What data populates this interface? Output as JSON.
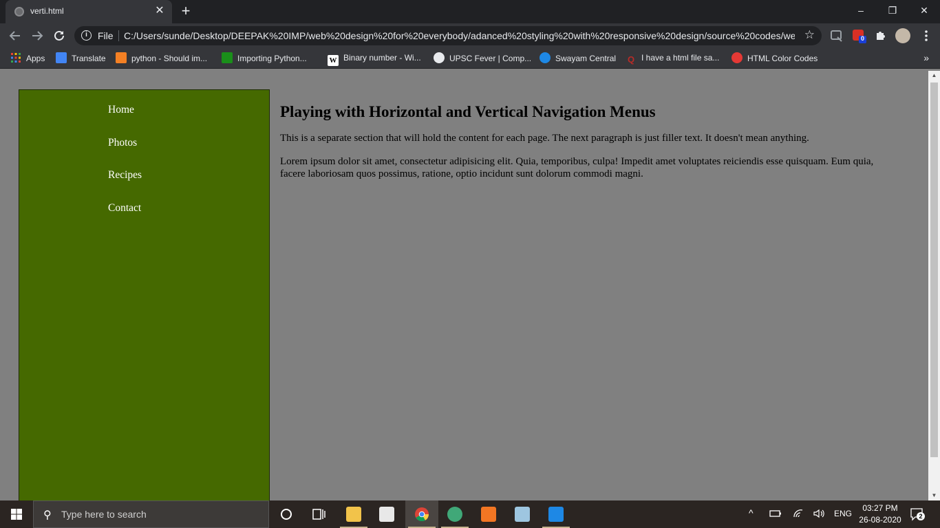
{
  "browser": {
    "tab_title": "verti.html",
    "tab_close": "✕",
    "new_tab": "+",
    "file_label": "File",
    "url": "C:/Users/sunde/Desktop/DEEPAK%20IMP/web%20design%20for%20everybody/adanced%20styling%20with%20responsive%20design/source%20codes/we...",
    "extension_badge": "0",
    "window_controls": [
      "–",
      "❐",
      "✕"
    ]
  },
  "bookmarks": [
    {
      "label": "Apps",
      "icon": "apps-grid-icon",
      "color": "#e94235"
    },
    {
      "label": "Translate",
      "icon": "translate-icon",
      "color": "#4285f4"
    },
    {
      "label": "python - Should im...",
      "icon": "stackoverflow-icon",
      "color": "#f48024"
    },
    {
      "label": "Importing Python...",
      "icon": "green-square-icon",
      "color": "#1a8f1a"
    },
    {
      "label": "Binary number - Wi...",
      "icon": "wikipedia-icon",
      "color": "#ffffff"
    },
    {
      "label": "UPSC Fever | Comp...",
      "icon": "globe-icon",
      "color": "#e8eaed"
    },
    {
      "label": "Swayam Central",
      "icon": "swayam-icon",
      "color": "#1e88e5"
    },
    {
      "label": "I have a html file sa...",
      "icon": "quora-icon",
      "color": "#b92b27"
    },
    {
      "label": "HTML Color Codes",
      "icon": "color-codes-icon",
      "color": "#e53935"
    }
  ],
  "page": {
    "nav": [
      "Home",
      "Photos",
      "Recipes",
      "Contact"
    ],
    "heading": "Playing with Horizontal and Vertical Navigation Menus",
    "para1": "This is a separate section that will hold the content for each page. The next paragraph is just filler text. It doesn't mean anything.",
    "para2": "Lorem ipsum dolor sit amet, consectetur adipisicing elit. Quia, temporibus, culpa! Impedit amet voluptates reiciendis esse quisquam. Eum quia, facere laboriosam quos possimus, ratione, optio incidunt sunt dolorum commodi magni.",
    "nav_bg_color": "#456900",
    "page_bg_color": "#808080"
  },
  "taskbar": {
    "search_placeholder": "Type here to search",
    "lang": "ENG",
    "time": "03:27 PM",
    "date": "26-08-2020",
    "notification_count": "2"
  }
}
